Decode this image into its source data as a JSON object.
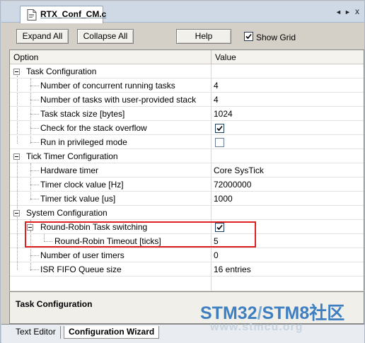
{
  "window": {
    "file_tab": "RTX_Conf_CM.c",
    "controls": [
      "◄",
      "►",
      "x"
    ]
  },
  "toolbar": {
    "expand_all": "Expand All",
    "collapse_all": "Collapse All",
    "help": "Help",
    "show_grid_label": "Show Grid",
    "show_grid_checked": true
  },
  "grid": {
    "headers": {
      "option": "Option",
      "value": "Value"
    },
    "rows": [
      {
        "label": "Task Configuration",
        "value": ""
      },
      {
        "label": "Number of concurrent running tasks",
        "value": "4"
      },
      {
        "label": "Number of tasks with user-provided stack",
        "value": "4"
      },
      {
        "label": "Task stack size [bytes]",
        "value": "1024"
      },
      {
        "label": "Check for the stack overflow",
        "checked": true
      },
      {
        "label": "Run in privileged mode",
        "checked": false
      },
      {
        "label": "Tick Timer Configuration",
        "value": ""
      },
      {
        "label": "Hardware timer",
        "value": "Core SysTick"
      },
      {
        "label": "Timer clock value [Hz]",
        "value": "72000000"
      },
      {
        "label": "Timer tick value [us]",
        "value": "1000"
      },
      {
        "label": "System Configuration",
        "value": ""
      },
      {
        "label": "Round-Robin Task switching",
        "checked": true
      },
      {
        "label": "Round-Robin Timeout [ticks]",
        "value": "5"
      },
      {
        "label": "Number of user timers",
        "value": "0"
      },
      {
        "label": "ISR FIFO Queue size",
        "value": "16 entries"
      }
    ]
  },
  "description": {
    "title": "Task Configuration"
  },
  "bottom_tabs": {
    "text_editor": "Text Editor",
    "config_wizard": "Configuration Wizard"
  },
  "watermark": {
    "brand_a": "STM32",
    "sep": "/",
    "brand_b": "STM8社区",
    "url": "www.stmcu.org"
  },
  "colors": {
    "highlight": "#e02020",
    "watermark_blue": "#3e7fc1",
    "watermark_dark": "#1f4f86"
  }
}
